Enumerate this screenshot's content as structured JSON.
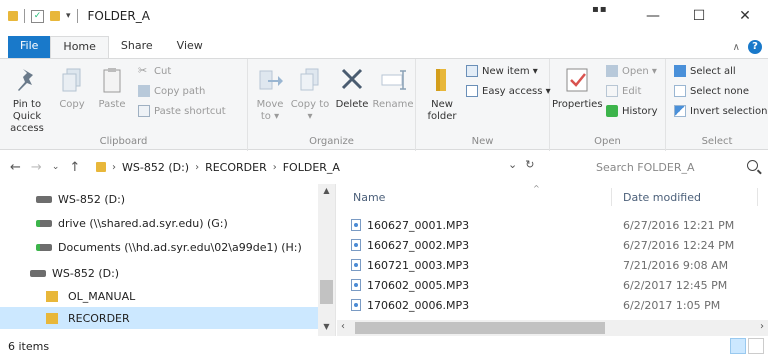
{
  "window": {
    "title": "FOLDER_A",
    "controls": {
      "minimize": "—",
      "maximize": "☐",
      "close": "✕"
    },
    "dots": "▪▪"
  },
  "tabs": {
    "file": "File",
    "home": "Home",
    "share": "Share",
    "view": "View"
  },
  "ribbon": {
    "clipboard": {
      "label": "Clipboard",
      "pin": "Pin to Quick access",
      "copy": "Copy",
      "paste": "Paste",
      "cut": "Cut",
      "copy_path": "Copy path",
      "paste_shortcut": "Paste shortcut"
    },
    "organize": {
      "label": "Organize",
      "move_to": "Move to ▾",
      "copy_to": "Copy to ▾",
      "delete": "Delete",
      "rename": "Rename"
    },
    "new": {
      "label": "New",
      "new_folder": "New folder",
      "new_item": "New item ▾",
      "easy_access": "Easy access ▾"
    },
    "open": {
      "label": "Open",
      "properties": "Properties",
      "open": "Open ▾",
      "edit": "Edit",
      "history": "History"
    },
    "select": {
      "label": "Select",
      "select_all": "Select all",
      "select_none": "Select none",
      "invert": "Invert selection"
    }
  },
  "address": {
    "crumbs": [
      "WS-852 (D:)",
      "RECORDER",
      "FOLDER_A"
    ],
    "search_placeholder": "Search FOLDER_A"
  },
  "navpane": {
    "items": [
      {
        "label": "WS-852 (D:)",
        "type": "drive",
        "indent": 36
      },
      {
        "label": "drive (\\\\shared.ad.syr.edu) (G:)",
        "type": "net",
        "indent": 36
      },
      {
        "label": "Documents (\\\\hd.ad.syr.edu\\02\\a99de1) (H:)",
        "type": "net",
        "indent": 36
      },
      {
        "label": "WS-852 (D:)",
        "type": "drive",
        "indent": 30
      },
      {
        "label": "OL_MANUAL",
        "type": "folder",
        "indent": 46
      },
      {
        "label": "RECORDER",
        "type": "folder",
        "indent": 46,
        "selected": true
      }
    ]
  },
  "content": {
    "columns": {
      "name": "Name",
      "date": "Date modified"
    },
    "files": [
      {
        "name": "160627_0001.MP3",
        "date": "6/27/2016 12:21 PM"
      },
      {
        "name": "160627_0002.MP3",
        "date": "6/27/2016 12:24 PM"
      },
      {
        "name": "160721_0003.MP3",
        "date": "7/21/2016 9:08 AM"
      },
      {
        "name": "170602_0005.MP3",
        "date": "6/2/2017 12:45 PM"
      },
      {
        "name": "170602_0006.MP3",
        "date": "6/2/2017 1:05 PM"
      }
    ]
  },
  "status": {
    "items_count": "6 items"
  },
  "colors": {
    "accent": "#1979ca",
    "folder": "#e8b73a",
    "selection": "#cce8ff"
  }
}
